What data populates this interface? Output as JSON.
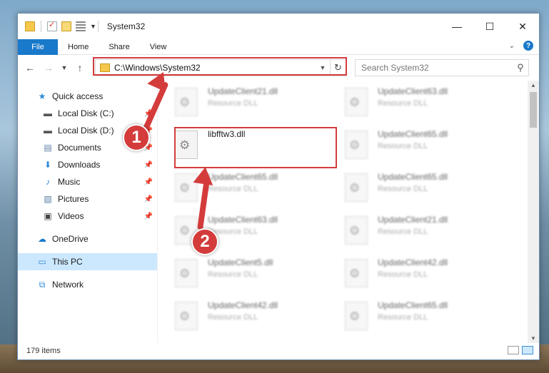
{
  "window": {
    "title": "System32",
    "controls": {
      "minimize": "—",
      "maximize": "☐",
      "close": "✕"
    }
  },
  "ribbon": {
    "tabs": [
      "File",
      "Home",
      "Share",
      "View"
    ],
    "help": "?",
    "expand": "⌄"
  },
  "address": {
    "path": "C:\\Windows\\System32",
    "search_placeholder": "Search System32"
  },
  "nav": {
    "quick_access": "Quick access",
    "items": [
      {
        "label": "Local Disk (C:)",
        "icon": "drive-icon"
      },
      {
        "label": "Local Disk (D:)",
        "icon": "drive-icon"
      },
      {
        "label": "Documents",
        "icon": "documents-icon"
      },
      {
        "label": "Downloads",
        "icon": "downloads-icon"
      },
      {
        "label": "Music",
        "icon": "music-icon"
      },
      {
        "label": "Pictures",
        "icon": "pictures-icon"
      },
      {
        "label": "Videos",
        "icon": "videos-icon"
      }
    ],
    "onedrive": "OneDrive",
    "thispc": "This PC",
    "network": "Network"
  },
  "files": {
    "highlighted": {
      "name": "libfftw3.dll"
    },
    "blurred": [
      {
        "name": "UpdateClient21.dll",
        "type": "Resource DLL"
      },
      {
        "name": "UpdateClient63.dll",
        "type": "Resource DLL"
      },
      {
        "name": "UpdateClient65.dll",
        "type": "Resource DLL"
      },
      {
        "name": "UpdateClient65.dll",
        "type": "Resource DLL"
      },
      {
        "name": "UpdateClient65.dll",
        "type": "Resource DLL"
      },
      {
        "name": "UpdateClient63.dll",
        "type": "Resource DLL"
      },
      {
        "name": "UpdateClient21.dll",
        "type": "Resource DLL"
      },
      {
        "name": "UpdateClient5.dll",
        "type": "Resource DLL"
      },
      {
        "name": "UpdateClient42.dll",
        "type": "Resource DLL"
      },
      {
        "name": "UpdateClient42.dll",
        "type": "Resource DLL"
      },
      {
        "name": "UpdateClient65.dll",
        "type": "Resource DLL"
      }
    ]
  },
  "status": {
    "count": "179 items"
  },
  "annotations": {
    "step1": "1",
    "step2": "2"
  },
  "colors": {
    "accent": "#1979ca",
    "annotation": "#d43c3c",
    "selected": "#cce8ff"
  }
}
